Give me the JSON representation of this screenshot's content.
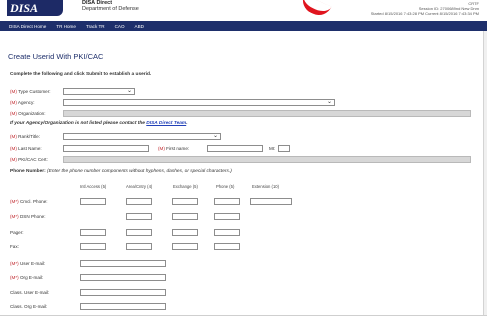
{
  "header": {
    "logo_text": "DISA",
    "title_top": "DISA Direct",
    "title_bottom": "Department of Defense",
    "session_line1": "CRTF",
    "session_line2": "Session ID: 2700689nd New Dnm",
    "session_line3": "Started 8/15/2016 7:43:28 PM Current 8/15/2016 7:43:34 PM"
  },
  "nav": [
    "DISA Direct Home",
    "TR Home",
    "Track TR",
    "CAO",
    "ABD"
  ],
  "page": {
    "title": "Create Userid With PKI/CAC",
    "intro": "Complete the following and click Submit to establish a userid."
  },
  "required_mark": "(M)",
  "required_mark_star": "(M*)",
  "labels": {
    "type_customer": "Type Customer:",
    "agency": "Agency:",
    "organization": "Organization:",
    "warn_text": "If your Agency/Organization is not listed please contact the ",
    "warn_link": "DISA Direct Team",
    "warn_end": ".",
    "rank_title": "Rank/Title:",
    "last_name": "Last Name:",
    "first_name": "First name:",
    "mi": "MI:",
    "pki_cert": "PKI/CAC Cert:",
    "phone_number": "Phone Number:",
    "phone_instructions": " (Enter the phone number components without hyphens, dashes, or special characters.)",
    "cmcl_phone": "Cmcl. Phone:",
    "dsn_phone": "DSN Phone:",
    "pager": "Pager:",
    "fax": "Fax:",
    "user_email": "User E-mail:",
    "org_email": "Org E-mail:",
    "class_user_email": "Class. User E-mail:",
    "class_org_email": "Class. Org E-mail:"
  },
  "phone_columns": [
    "Intl Access (5)",
    "Area/Cntry (4)",
    "Exchange (5)",
    "Phone (5)",
    "Extension (10)"
  ]
}
